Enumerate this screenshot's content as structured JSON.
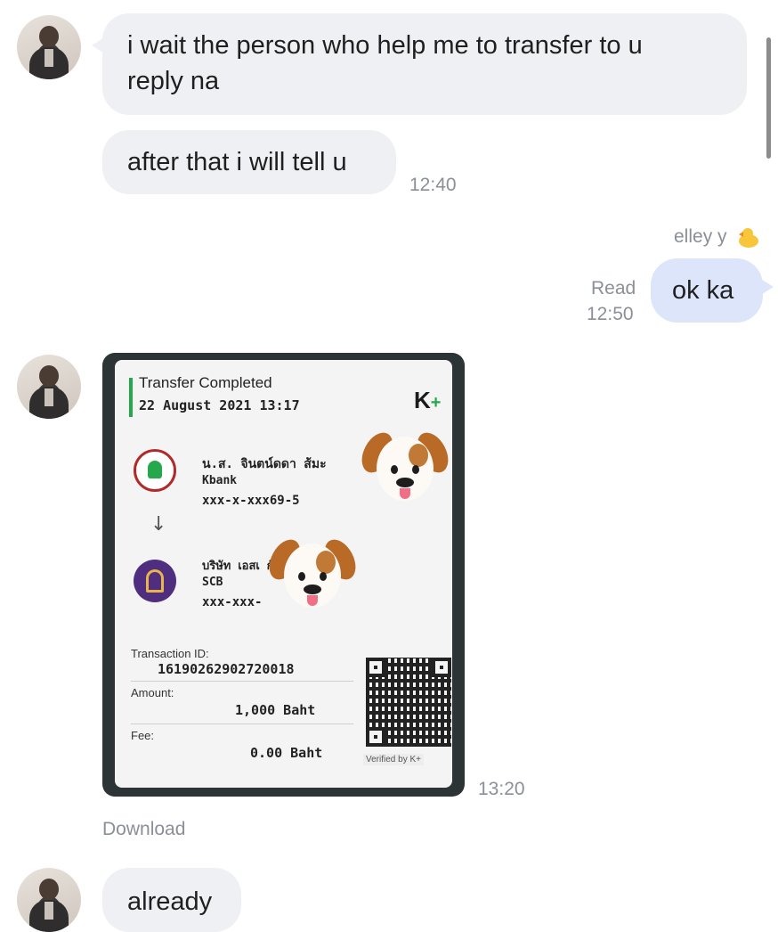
{
  "messages": {
    "m1": {
      "text_line1": "i wait the person who help me to transfer to u",
      "text_line2": "reply na"
    },
    "m2": {
      "text": "after that i will tell u",
      "time": "12:40"
    },
    "m3": {
      "sender": "elley y",
      "text": "ok ka",
      "status": "Read",
      "time": "12:50"
    },
    "m4": {
      "time": "13:20",
      "download_label": "Download"
    },
    "m5": {
      "text": "already"
    }
  },
  "slip": {
    "title": "Transfer Completed",
    "date": "22 August 2021 13:17",
    "brand": "K",
    "brand_plus": "+",
    "from_name": "น.ส. จินตน์ดดา ส้มะ",
    "from_bank": "Kbank",
    "from_account": "xxx-x-xxx69-5",
    "arrow": "↓",
    "to_name": "บริษัท เอสเ   กัด",
    "to_bank": "SCB",
    "to_account": "xxx-xxx-",
    "transaction_label": "Transaction ID:",
    "transaction_id": "16190262902720018",
    "amount_label": "Amount:",
    "amount": "1,000 Baht",
    "fee_label": "Fee:",
    "fee": "0.00 Baht",
    "verified": "Verified by K+"
  },
  "icons": {
    "avatar": "user-avatar",
    "sticker": "puppy-face-emoji",
    "sender_emoji": "chick-emoji"
  },
  "colors": {
    "incoming_bubble": "#eef0f4",
    "outgoing_bubble": "#dde5fb",
    "kbank_green": "#24a84b",
    "scb_purple": "#4f2d7f"
  }
}
